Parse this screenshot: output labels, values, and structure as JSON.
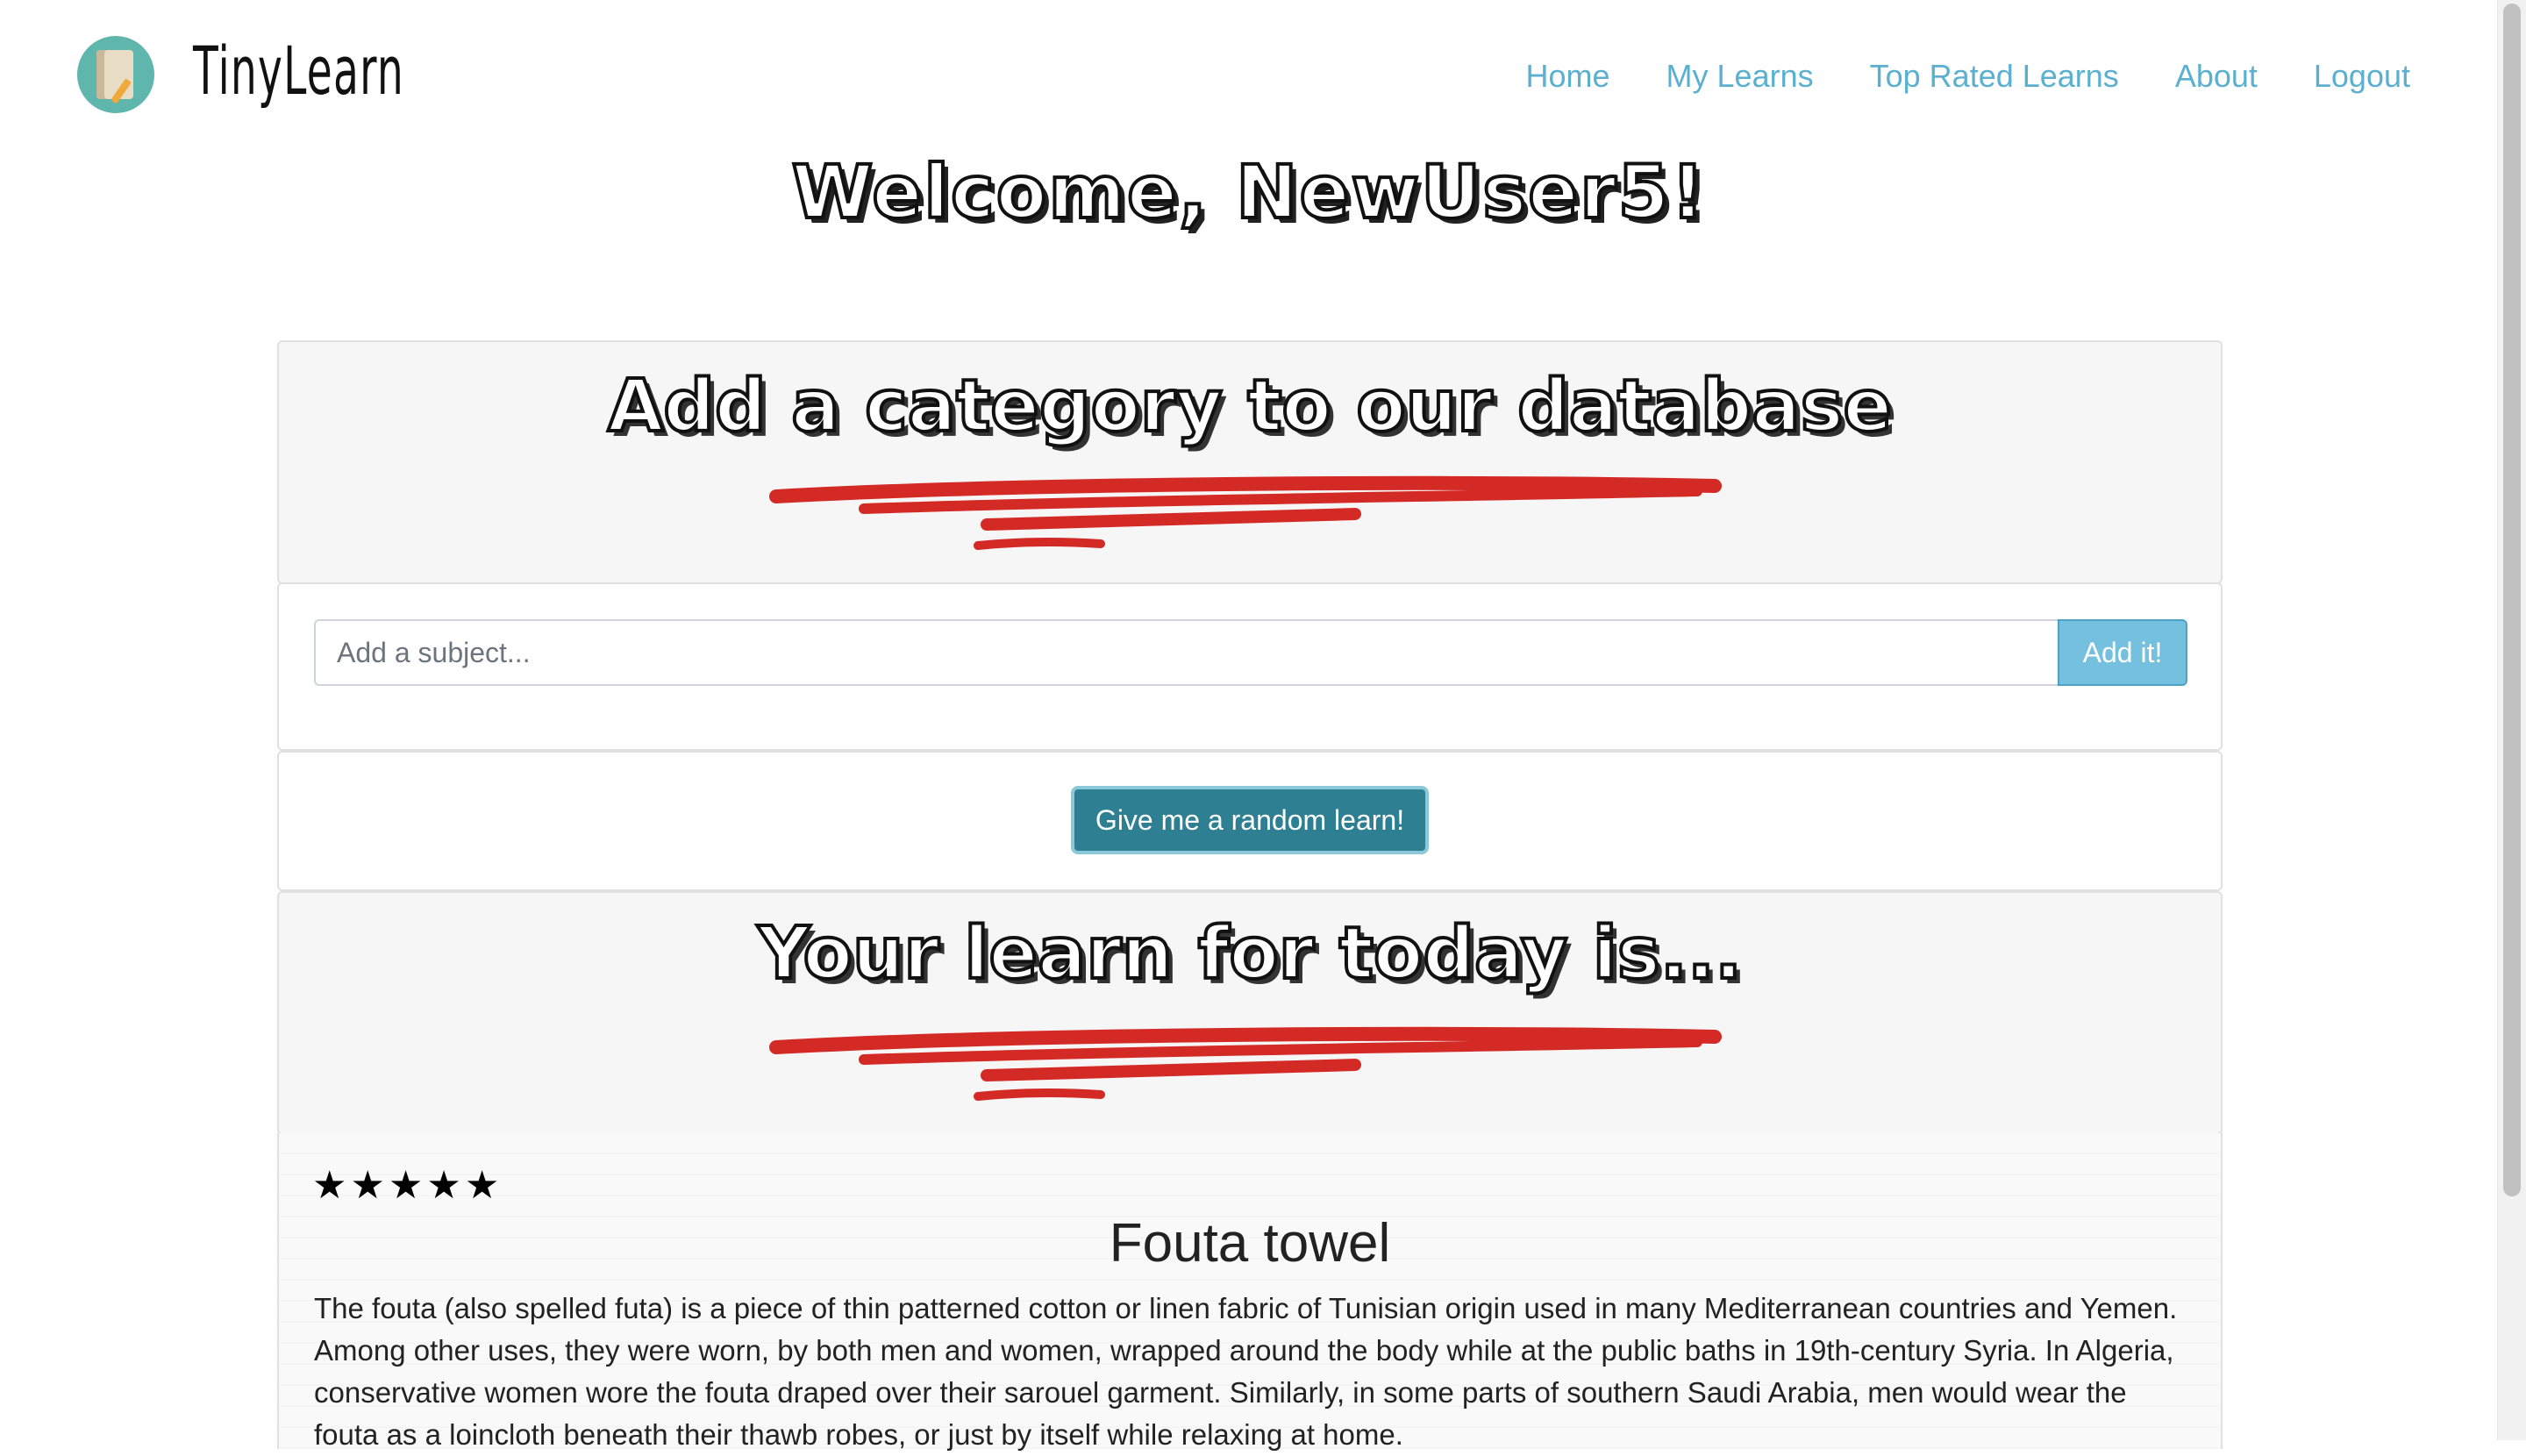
{
  "brand": {
    "name": "TinyLearn"
  },
  "nav": {
    "items": [
      "Home",
      "My Learns",
      "Top Rated Learns",
      "About",
      "Logout"
    ]
  },
  "welcome": "Welcome, NewUser5!",
  "add_category": {
    "title": "Add a category to our database",
    "placeholder": "Add a subject...",
    "button": "Add it!"
  },
  "random": {
    "button": "Give me a random learn!"
  },
  "today": {
    "title": "Your learn for today is..."
  },
  "learn": {
    "rating": 5,
    "rating_max": 5,
    "title": "Fouta towel",
    "text": "The fouta (also spelled futa) is a piece of thin patterned cotton or linen fabric of Tunisian origin used in many Mediterranean countries and Yemen. Among other uses, they were worn, by both men and women, wrapped around the body while at the public baths in 19th-century Syria. In Algeria, conservative women wore the fouta draped over their sarouel garment. Similarly, in some parts of southern Saudi Arabia, men would wear the fouta as a loincloth beneath their thawb robes, or just by itself while relaxing at home."
  },
  "colors": {
    "nav_link": "#5bb0d0",
    "accent_button": "#2f7f92",
    "add_button": "#74c0de",
    "brush": "#d42a25"
  }
}
